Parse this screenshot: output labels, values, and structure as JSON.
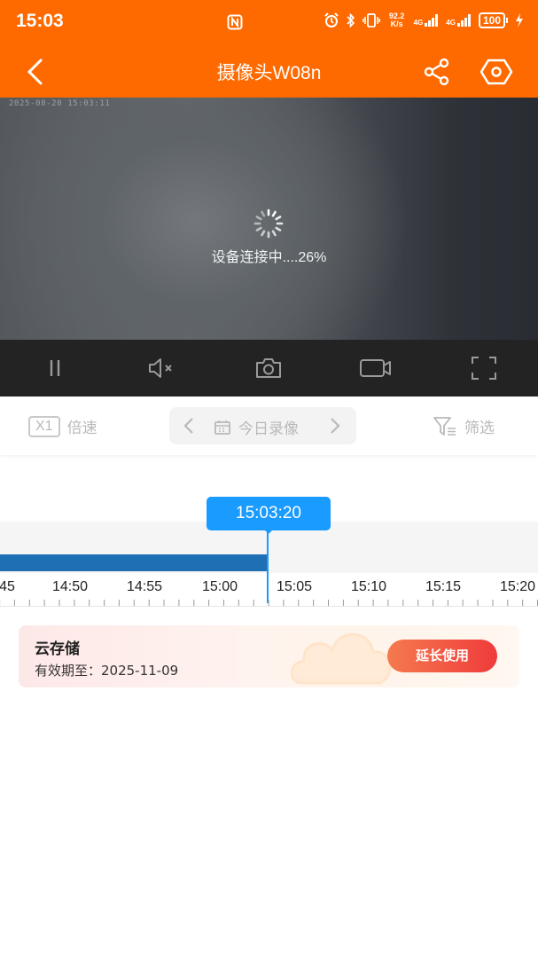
{
  "status_bar": {
    "time": "15:03",
    "net_speed": "92.2 K/s",
    "network_1": "4G",
    "network_2": "4G",
    "battery": "100"
  },
  "header": {
    "title": "摄像头W08n"
  },
  "video": {
    "osd_timestamp": "2025-08-20 15:03:11",
    "loading_text": "设备连接中....26%",
    "progress_percent": 26
  },
  "toolbar": {
    "speed_badge": "X1",
    "speed_label": "倍速",
    "date_label": "今日录像",
    "filter_label": "筛选"
  },
  "timeline": {
    "current_time": "15:03:20",
    "tick_labels": [
      "45",
      "14:50",
      "14:55",
      "15:00",
      "15:05",
      "15:10",
      "15:15",
      "15:20"
    ]
  },
  "cloud_storage": {
    "title": "云存储",
    "expire_text": "有效期至：2025-11-09",
    "extend_button": "延长使用"
  },
  "colors": {
    "brand": "#ff6a00",
    "timeline_accent": "#1a9bff",
    "recorded_segment": "#1f6fb5"
  }
}
